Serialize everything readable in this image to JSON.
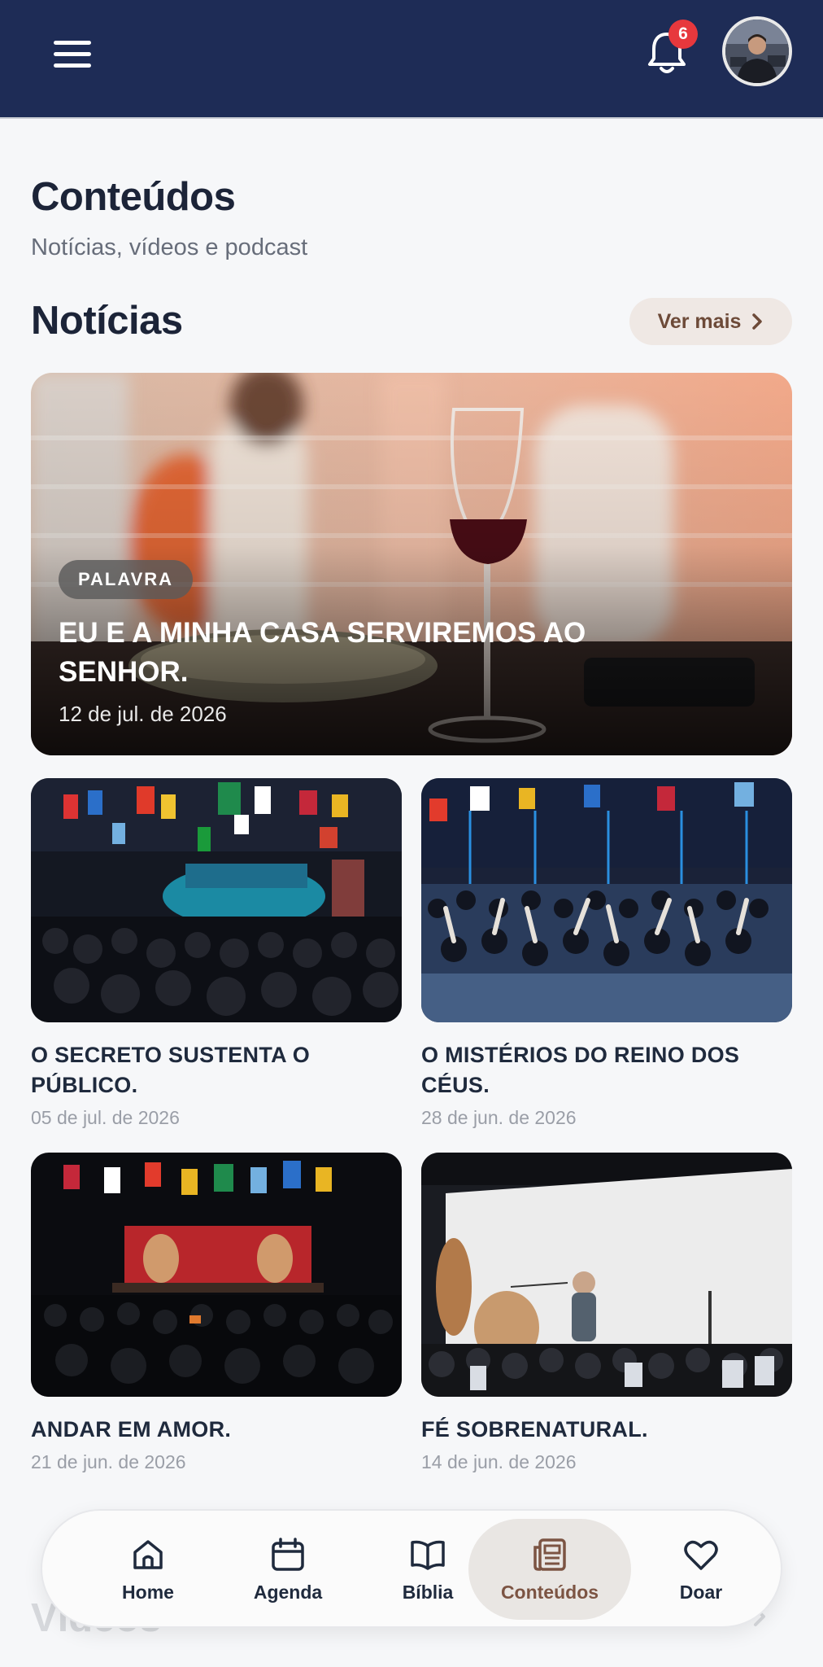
{
  "header": {
    "notification_count": "6",
    "menu_icon": "hamburger-menu-icon",
    "bell_icon": "bell-icon",
    "colors": {
      "bar": "#1e2c56",
      "badge": "#e7383d"
    }
  },
  "page": {
    "title": "Conteúdos",
    "subtitle": "Notícias, vídeos e podcast"
  },
  "news": {
    "section_title": "Notícias",
    "see_more_label": "Ver mais",
    "featured": {
      "tag": "PALAVRA",
      "title": "EU E A MINHA CASA SERVIREMOS AO SENHOR.",
      "date": "12 de jul. de 2026"
    },
    "items": [
      {
        "title": "O SECRETO SUSTENTA O PÚBLICO.",
        "date": "05 de jul. de 2026"
      },
      {
        "title": "O MISTÉRIOS DO REINO DOS CÉUS.",
        "date": "28 de jun. de 2026"
      },
      {
        "title": "ANDAR EM AMOR.",
        "date": "21 de jun. de 2026"
      },
      {
        "title": "FÉ SOBRENATURAL.",
        "date": "14 de jun. de 2026"
      }
    ]
  },
  "videos": {
    "section_title": "Vídeos"
  },
  "tabbar": {
    "active": "Conteúdos",
    "accent": "#7c5443",
    "items": [
      {
        "label": "Home",
        "icon": "home-icon"
      },
      {
        "label": "Agenda",
        "icon": "calendar-icon"
      },
      {
        "label": "Bíblia",
        "icon": "book-icon"
      },
      {
        "label": "Conteúdos",
        "icon": "newspaper-icon"
      },
      {
        "label": "Doar",
        "icon": "heart-icon"
      }
    ]
  }
}
